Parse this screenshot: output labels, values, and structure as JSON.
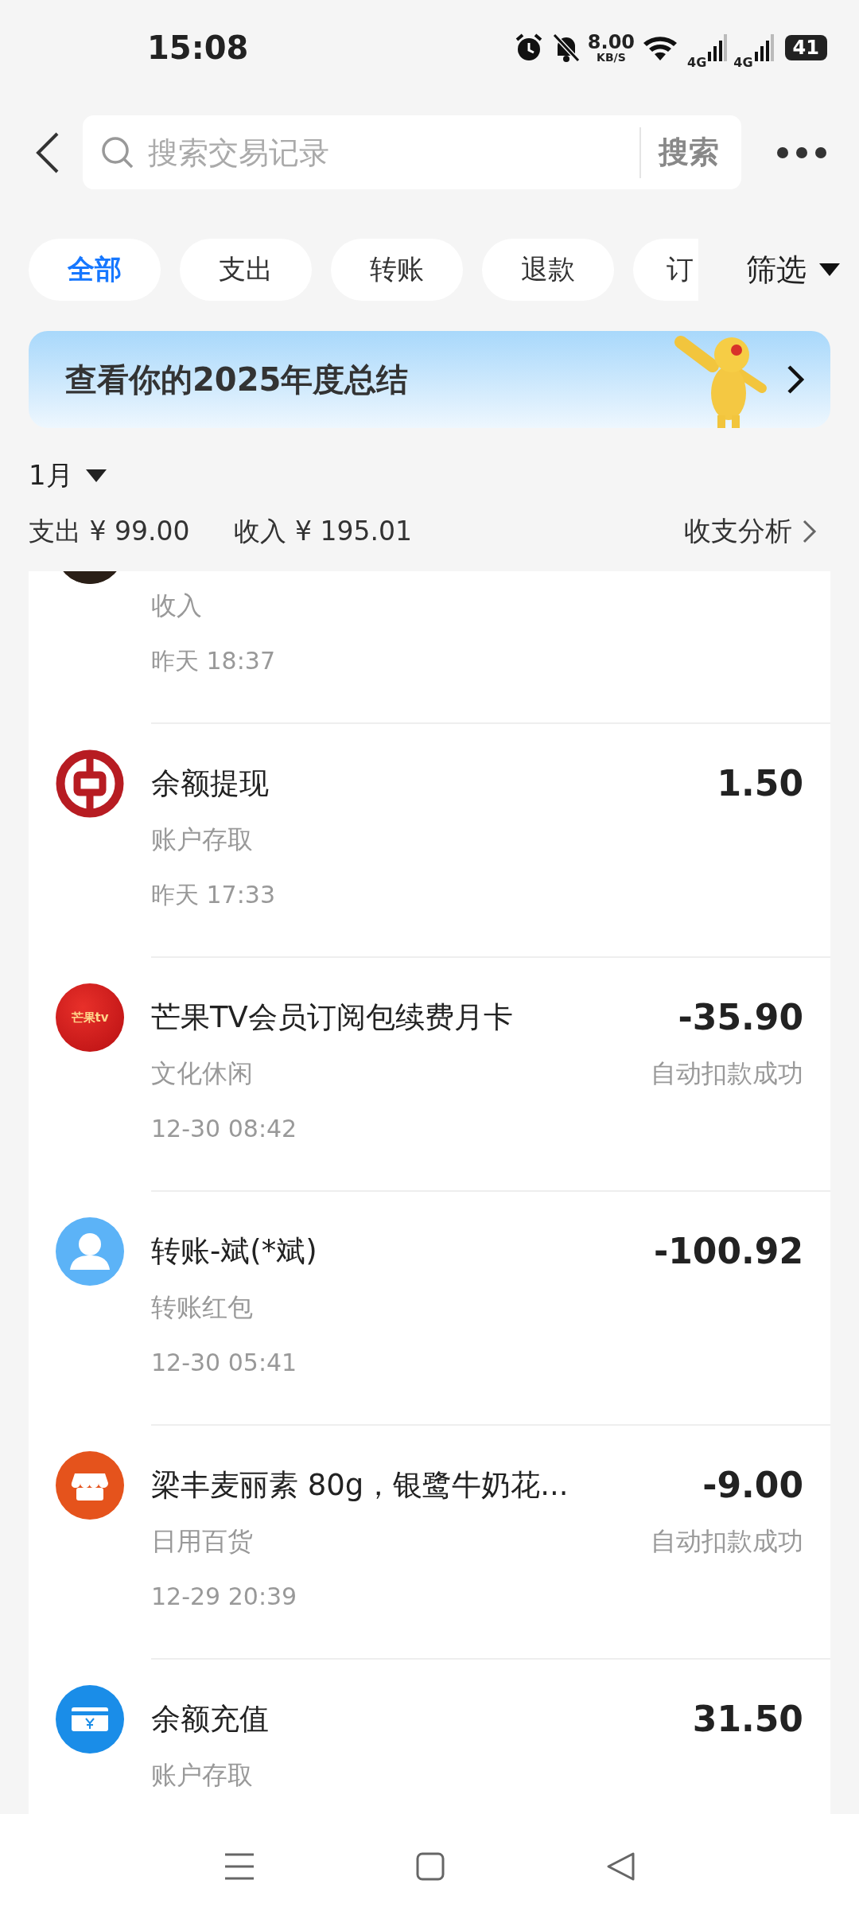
{
  "status_bar": {
    "time": "15:08",
    "speed": "8.00",
    "speed_unit": "KB/S",
    "network_1": "4G",
    "network_2": "4G",
    "battery": "41"
  },
  "search": {
    "placeholder": "搜索交易记录",
    "button": "搜索"
  },
  "tabs": [
    {
      "label": "全部",
      "selected": true
    },
    {
      "label": "支出",
      "selected": false
    },
    {
      "label": "转账",
      "selected": false
    },
    {
      "label": "退款",
      "selected": false
    },
    {
      "label": "订",
      "selected": false
    }
  ],
  "filter": "筛选",
  "banner": {
    "title": "查看你的2025年度总结"
  },
  "month": {
    "label": "1月",
    "expense": "支出 ¥ 99.00",
    "income": "收入 ¥ 195.01",
    "analysis": "收支分析"
  },
  "transactions": [
    {
      "category": "收入",
      "time": "昨天 18:37"
    },
    {
      "kind": "bank",
      "title": "余额提现",
      "category": "账户存取",
      "time": "昨天 17:33",
      "amount": "1.50"
    },
    {
      "kind": "tv",
      "logo_text": "芒果tv",
      "title": "芒果TV会员订阅包续费月卡",
      "category": "文化休闲",
      "time": "12-30 08:42",
      "amount": "-35.90",
      "status": "自动扣款成功"
    },
    {
      "kind": "person",
      "title": "转账-斌(*斌)",
      "category": "转账红包",
      "time": "12-30 05:41",
      "amount": "-100.92"
    },
    {
      "kind": "shop",
      "title": "梁丰麦丽素 80g，银鹭牛奶花...",
      "category": "日用百货",
      "time": "12-29 20:39",
      "amount": "-9.00",
      "status": "自动扣款成功"
    },
    {
      "kind": "card",
      "title": "余额充值",
      "category": "账户存取",
      "amount": "31.50"
    }
  ]
}
